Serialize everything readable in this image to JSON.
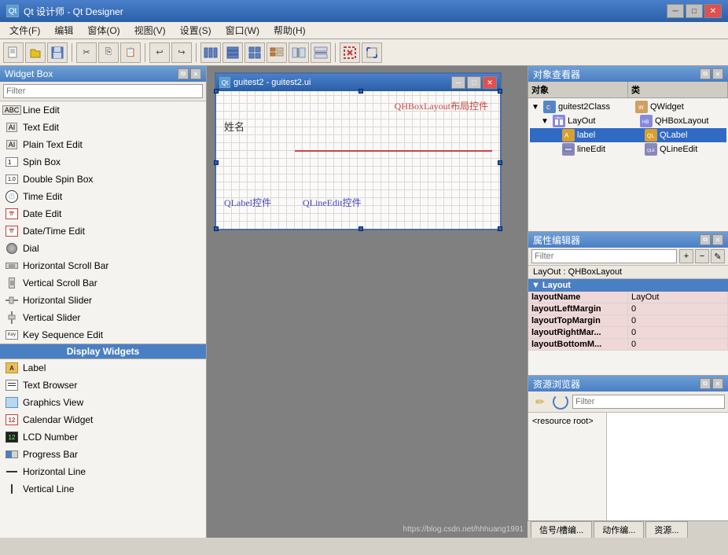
{
  "titlebar": {
    "icon": "Qt",
    "title": "Qt 设计师 - Qt Designer",
    "min_btn": "─",
    "max_btn": "□",
    "close_btn": "✕"
  },
  "menubar": {
    "items": [
      {
        "label": "文件(F)"
      },
      {
        "label": "编辑"
      },
      {
        "label": "窗体(O)"
      },
      {
        "label": "视图(V)"
      },
      {
        "label": "设置(S)"
      },
      {
        "label": "窗口(W)"
      },
      {
        "label": "帮助(H)"
      }
    ]
  },
  "widget_box": {
    "title": "Widget Box",
    "filter_placeholder": "Filter",
    "items": [
      {
        "label": "Line Edit",
        "icon": "lineedit-icon"
      },
      {
        "label": "Text Edit",
        "icon": "textedit-icon"
      },
      {
        "label": "Plain Text Edit",
        "icon": "plaintextedit-icon"
      },
      {
        "label": "Spin Box",
        "icon": "spinbox-icon"
      },
      {
        "label": "Double Spin Box",
        "icon": "doublespinbox-icon"
      },
      {
        "label": "Time Edit",
        "icon": "timeedit-icon"
      },
      {
        "label": "Date Edit",
        "icon": "dateedit-icon"
      },
      {
        "label": "Date/Time Edit",
        "icon": "datetimeedit-icon"
      },
      {
        "label": "Dial",
        "icon": "dial-icon"
      },
      {
        "label": "Horizontal Scroll Bar",
        "icon": "hscrollbar-icon"
      },
      {
        "label": "Vertical Scroll Bar",
        "icon": "vscrollbar-icon"
      },
      {
        "label": "Horizontal Slider",
        "icon": "hslider-icon"
      },
      {
        "label": "Vertical Slider",
        "icon": "vslider-icon"
      },
      {
        "label": "Key Sequence Edit",
        "icon": "keyseq-icon"
      }
    ],
    "category_display": "Display Widgets",
    "display_items": [
      {
        "label": "Label",
        "icon": "label-icon"
      },
      {
        "label": "Text Browser",
        "icon": "textbrowser-icon"
      },
      {
        "label": "Graphics View",
        "icon": "graphics-icon"
      },
      {
        "label": "Calendar Widget",
        "icon": "calendar-icon"
      },
      {
        "label": "LCD Number",
        "icon": "lcd-icon"
      },
      {
        "label": "Progress Bar",
        "icon": "progressbar-icon"
      },
      {
        "label": "Horizontal Line",
        "icon": "hline-icon"
      },
      {
        "label": "Vertical Line",
        "icon": "vline-icon"
      }
    ]
  },
  "design_window": {
    "title": "guitest2 - guitest2.ui",
    "layout_label": "QHBoxLayout布局控件",
    "qlabel_ctrl": "QLabel控件",
    "qlineedit_ctrl": "QLineEdit控件",
    "name_label": "姓名"
  },
  "obj_inspector": {
    "title": "对象查看器",
    "col_obj": "对象",
    "col_class": "类",
    "items": [
      {
        "level": 0,
        "expand": "▲",
        "obj": "guitest2Class",
        "class": "QWidget"
      },
      {
        "level": 1,
        "expand": "▲",
        "obj": "LayOut",
        "class": "QHBoxLayout"
      },
      {
        "level": 2,
        "expand": "",
        "obj": "label",
        "class": "QLabel"
      },
      {
        "level": 2,
        "expand": "",
        "obj": "lineEdit",
        "class": "QLineEdit"
      }
    ]
  },
  "prop_editor": {
    "title": "属性编辑器",
    "filter_placeholder": "Filter",
    "layout_label": "LayOut : QHBoxLayout",
    "group_label": "Layout",
    "properties": [
      {
        "name": "layoutName",
        "value": "LayOut",
        "highlighted": true
      },
      {
        "name": "layoutLeftMargin",
        "value": "0",
        "highlighted": true
      },
      {
        "name": "layoutTopMargin",
        "value": "0",
        "highlighted": true
      },
      {
        "name": "layoutRightMar...",
        "value": "0",
        "highlighted": true
      },
      {
        "name": "layoutBottomM...",
        "value": "0",
        "highlighted": true
      }
    ]
  },
  "resource_browser": {
    "title": "资源浏览器",
    "filter_placeholder": "Filter",
    "tree_item": "<resource root>",
    "tabs": [
      {
        "label": "信号/槽编..."
      },
      {
        "label": "动作编..."
      },
      {
        "label": "资源..."
      }
    ]
  },
  "watermark": "https://blog.csdn.net/hhhuang1991"
}
